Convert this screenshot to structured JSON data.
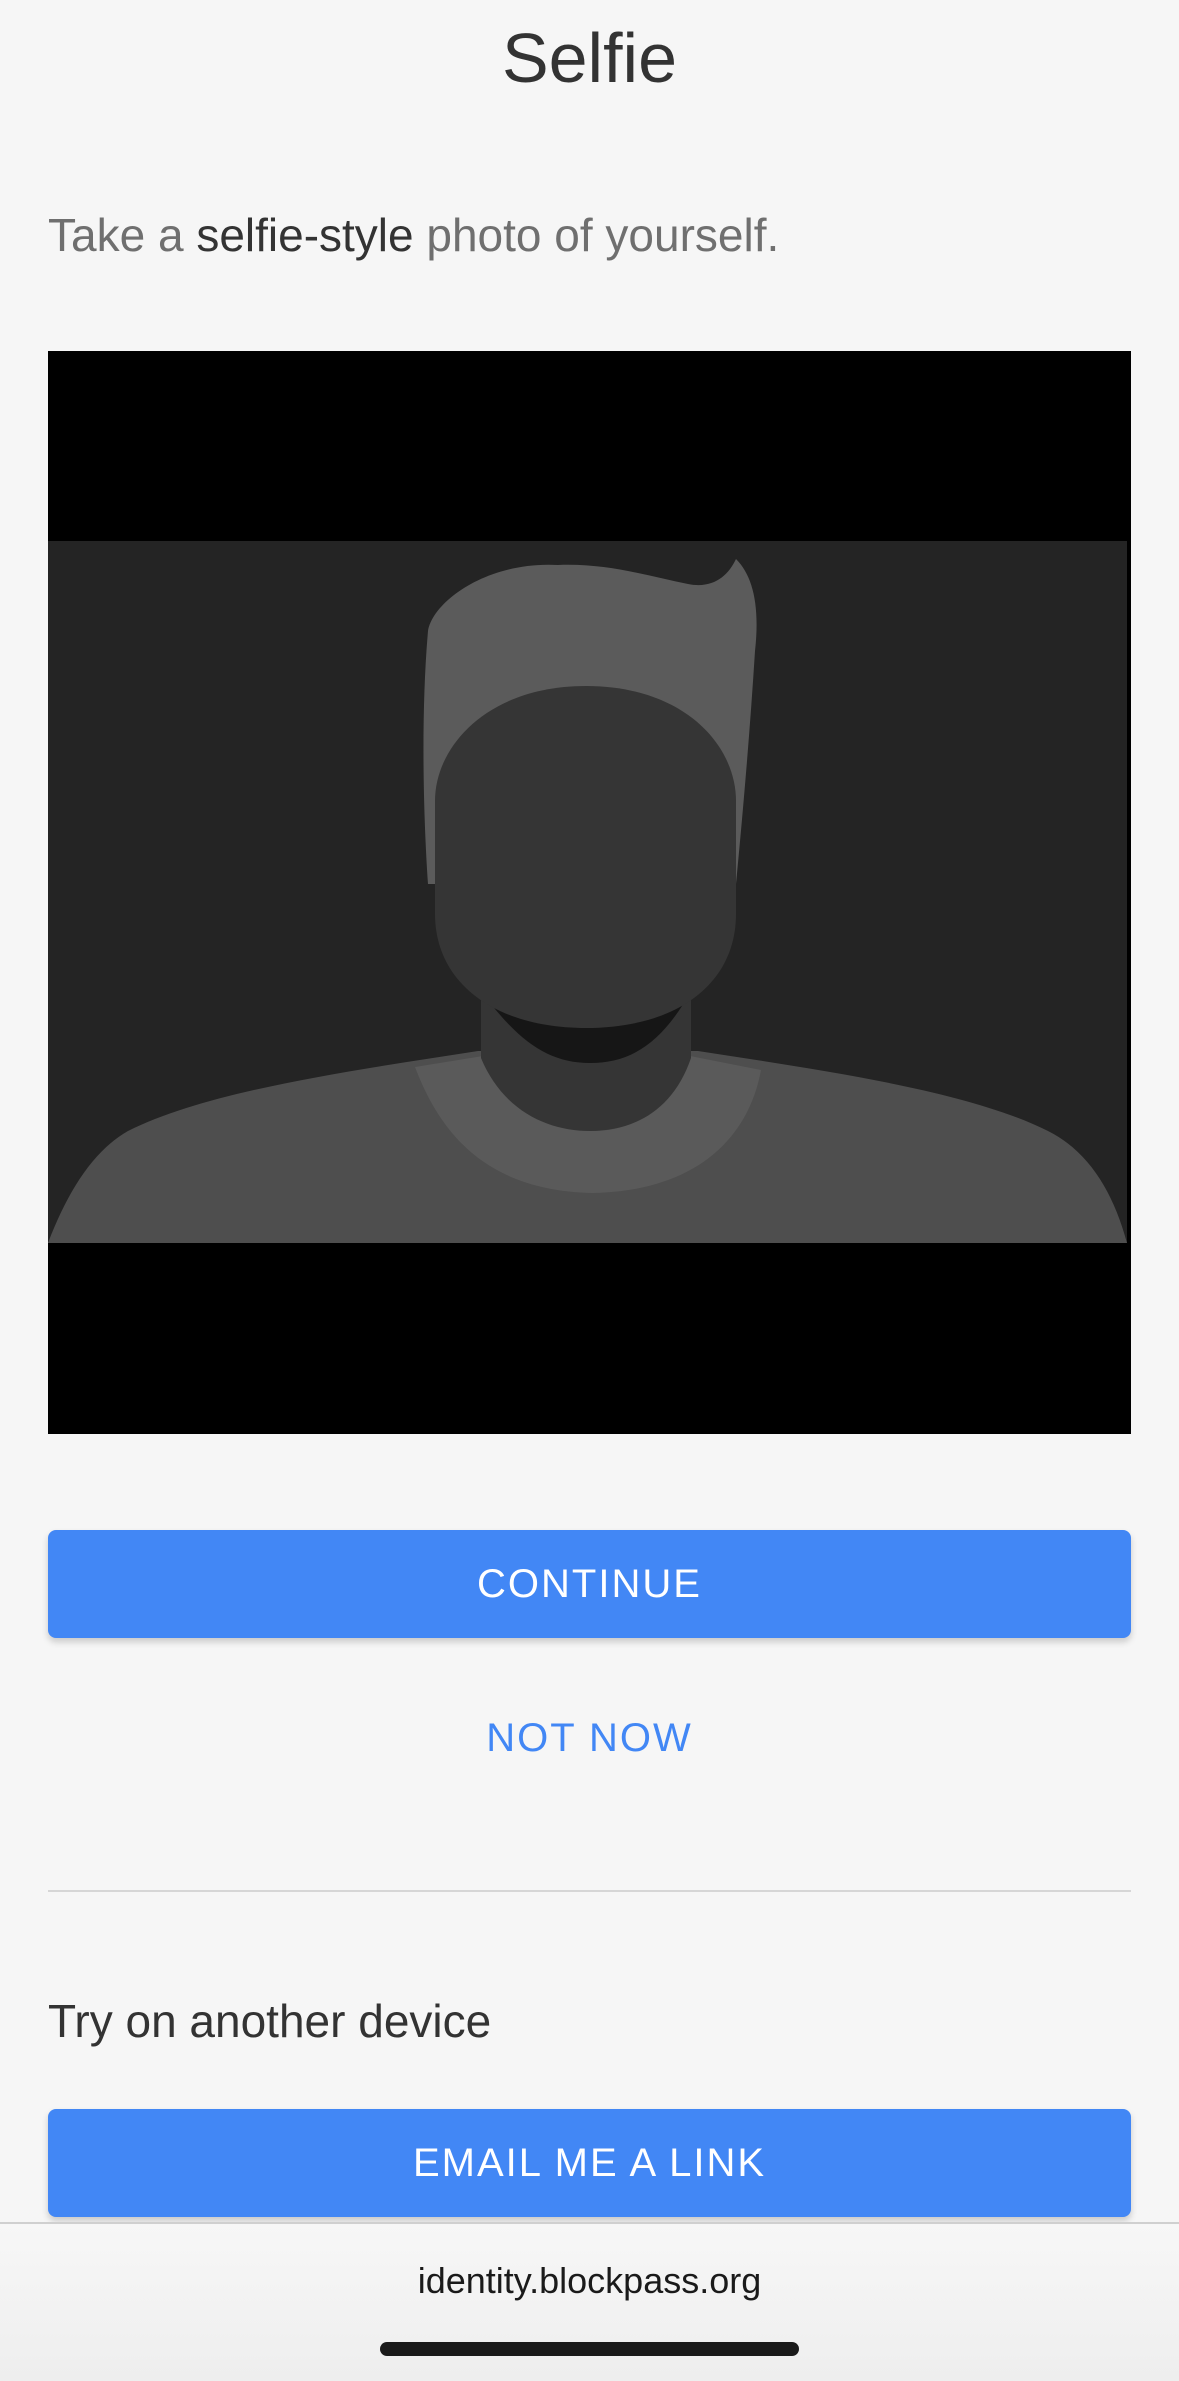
{
  "header": {
    "title": "Selfie"
  },
  "instruction": {
    "prefix": "Take a ",
    "emphasis": "selfie-style",
    "suffix": " photo of yourself."
  },
  "illustration": {
    "icon": "person-silhouette-icon"
  },
  "actions": {
    "continue_label": "CONTINUE",
    "not_now_label": "NOT NOW"
  },
  "other_device": {
    "heading": "Try on another device",
    "email_label": "EMAIL ME A LINK"
  },
  "browser": {
    "url": "identity.blockpass.org"
  },
  "colors": {
    "accent": "#4287f5",
    "background": "#f6f6f6",
    "text_dark": "#333333",
    "text_muted": "#6f6f6f"
  }
}
